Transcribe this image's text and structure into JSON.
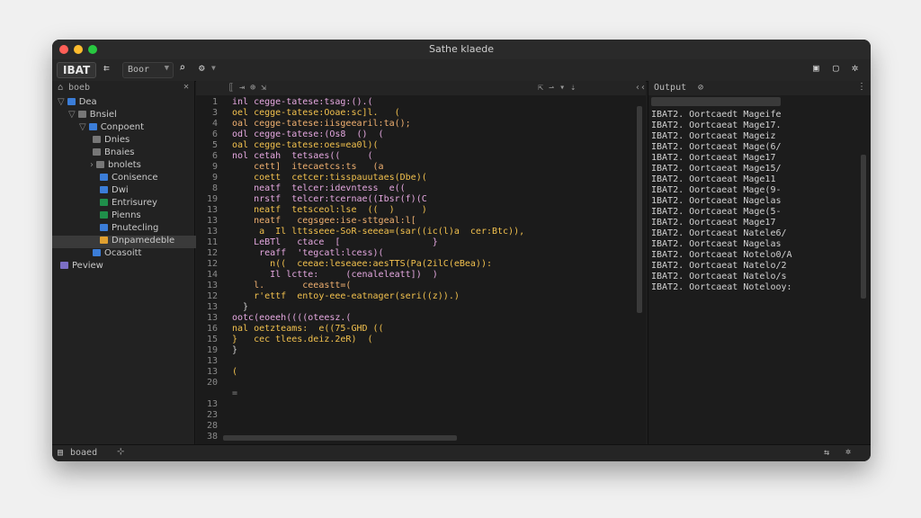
{
  "window": {
    "title": "Sathe klaede"
  },
  "toolbar": {
    "project_label": "IBAT",
    "select_value": "Boor"
  },
  "sidebar": {
    "header": "boeb",
    "items": [
      {
        "label": "Dea",
        "color": "#3b7dd8"
      },
      {
        "label": "Bnsiel",
        "color": "#777777"
      },
      {
        "label": "Conpoent",
        "color": "#3b7dd8"
      },
      {
        "label": "Dnies",
        "color": "#777777"
      },
      {
        "label": "Bnaies",
        "color": "#777777"
      },
      {
        "label": "bnolets",
        "color": "#777777"
      },
      {
        "label": "Conisence",
        "color": "#3b7dd8"
      },
      {
        "label": "Dwi",
        "color": "#3b7dd8"
      },
      {
        "label": "Entrisurey",
        "color": "#1f8f4a"
      },
      {
        "label": "Pienns",
        "color": "#1f8f4a"
      },
      {
        "label": "Pnutecling",
        "color": "#3b7dd8"
      },
      {
        "label": "Dnpamedeble",
        "color": "#e0a030"
      },
      {
        "label": "Ocasoitt",
        "color": "#3b7dd8"
      },
      {
        "label": "Peview",
        "color": "#7c6fc4"
      }
    ]
  },
  "editor": {
    "line_numbers": [
      "1",
      "3",
      "4",
      "6",
      "5",
      "6",
      "9",
      "9",
      "8",
      "19",
      "13",
      "13",
      "13",
      "11",
      "12",
      "12",
      "14",
      "13",
      "12",
      "13",
      "13",
      "16",
      "15",
      "19",
      "13",
      "13",
      "20",
      "",
      "13",
      "23",
      "28",
      "38"
    ],
    "lines": [
      {
        "text": "inl cegge-tatese:tsag:().(",
        "color": "#e5a8e0"
      },
      {
        "text": "oel cegge-tatese:Ooae:sc]l.   (",
        "color": "#f2c14e"
      },
      {
        "text": "oal cegge-tatese:iisgeearil:ta();",
        "color": "#f0b070"
      },
      {
        "text": "odl cegge-tatese:(Os8  ()  (",
        "color": "#e5a8e0"
      },
      {
        "text": "oal cegge-tatese:oes=ea0l)(",
        "color": "#f2c14e"
      },
      {
        "text": "nol cetah  tetsaes((     (",
        "color": "#e5a8e0"
      },
      {
        "text": "    cett]  itecaetcs:ts   (a",
        "color": "#f0b070"
      },
      {
        "text": "    coett  cetcer:tisspauutaes(Dbe)(",
        "color": "#f2c14e"
      },
      {
        "text": "    neatf  telcer:idevntess  e((",
        "color": "#e5a8e0"
      },
      {
        "text": "    nrstf  telcer:tcernae((Ibsr(f)(C",
        "color": "#e5a8e0"
      },
      {
        "text": "    neatf  tetsceol:lse  ((  )     )",
        "color": "#f2c14e"
      },
      {
        "text": "    neatf   cegsgee:ise-sttgeal:l[",
        "color": "#f0b070"
      },
      {
        "text": "     a  Il lttsseee-SoR-seeea=(sar((ic(l)a  cer:Btc)),",
        "color": "#f2c14e"
      },
      {
        "text": "    LeBTl   ctace  [                 }",
        "color": "#e5a8e0"
      },
      {
        "text": "     reaff  'tegcatl:lcess)(",
        "color": "#e5a8e0"
      },
      {
        "text": "       n((  ceeae:leseaee:aesTTS(Pa(2ilC(eBea)):",
        "color": "#f2c14e"
      },
      {
        "text": "       Il lctte:     (cenaleleatt])  )",
        "color": "#e5a8e0"
      },
      {
        "text": "    l.       ceeastt=(",
        "color": "#f0b070"
      },
      {
        "text": "    r'ettf  entoy-eee-eatnager(seri((z)).)",
        "color": "#f2c14e"
      },
      {
        "text": "  }",
        "color": "#d0d0d0"
      },
      {
        "text": "ootc(eoeeh((((oteesz.(",
        "color": "#e5a8e0"
      },
      {
        "text": "nal oetzteams:  e((75-GHD ((",
        "color": "#f2c14e"
      },
      {
        "text": "}   cec tlees.deiz.2eR)  (",
        "color": "#f2c14e"
      },
      {
        "text": "}",
        "color": "#d0d0d0"
      },
      {
        "text": "",
        "color": "#d0d0d0"
      },
      {
        "text": "(",
        "color": "#f2c14e"
      },
      {
        "text": "",
        "color": "#d0d0d0"
      },
      {
        "text": "=",
        "color": "#888888"
      }
    ]
  },
  "output": {
    "title": "Output",
    "lines": [
      "IBAT2. Oortcaedt Mageife",
      "IBAT2. Oortcaeat Mage17.",
      "IBAT2. Oortcaeat Mageiz",
      "IBAT2. Oortcaeat Mage(6/",
      "1BAT2. Oortcaeat Mage17",
      "IBAT2. Oortcaeat Mage15/",
      "IBAT2. Oortcaeat Mage11",
      "IBAT2. Oortcaeat Mage(9-",
      "1BAT2. Oortcaeat Nagelas",
      "IBAT2. Oortcaeat Mage(5-",
      "IBAT2. Oortcaeat Mage17",
      "IBAT2. Oortcaeat Natele6/",
      "IBAT2. Oortcaeat Nagelas",
      "IBAT2. Oortcaeat Notelo0/A",
      "IBAT2. Oortcaeat Natelo/2",
      "IBAT2. Oortcaeat Natelo/s",
      "IBAT2. Oortcaeat Notelooy:"
    ]
  },
  "statusbar": {
    "left_label": "boaed"
  }
}
